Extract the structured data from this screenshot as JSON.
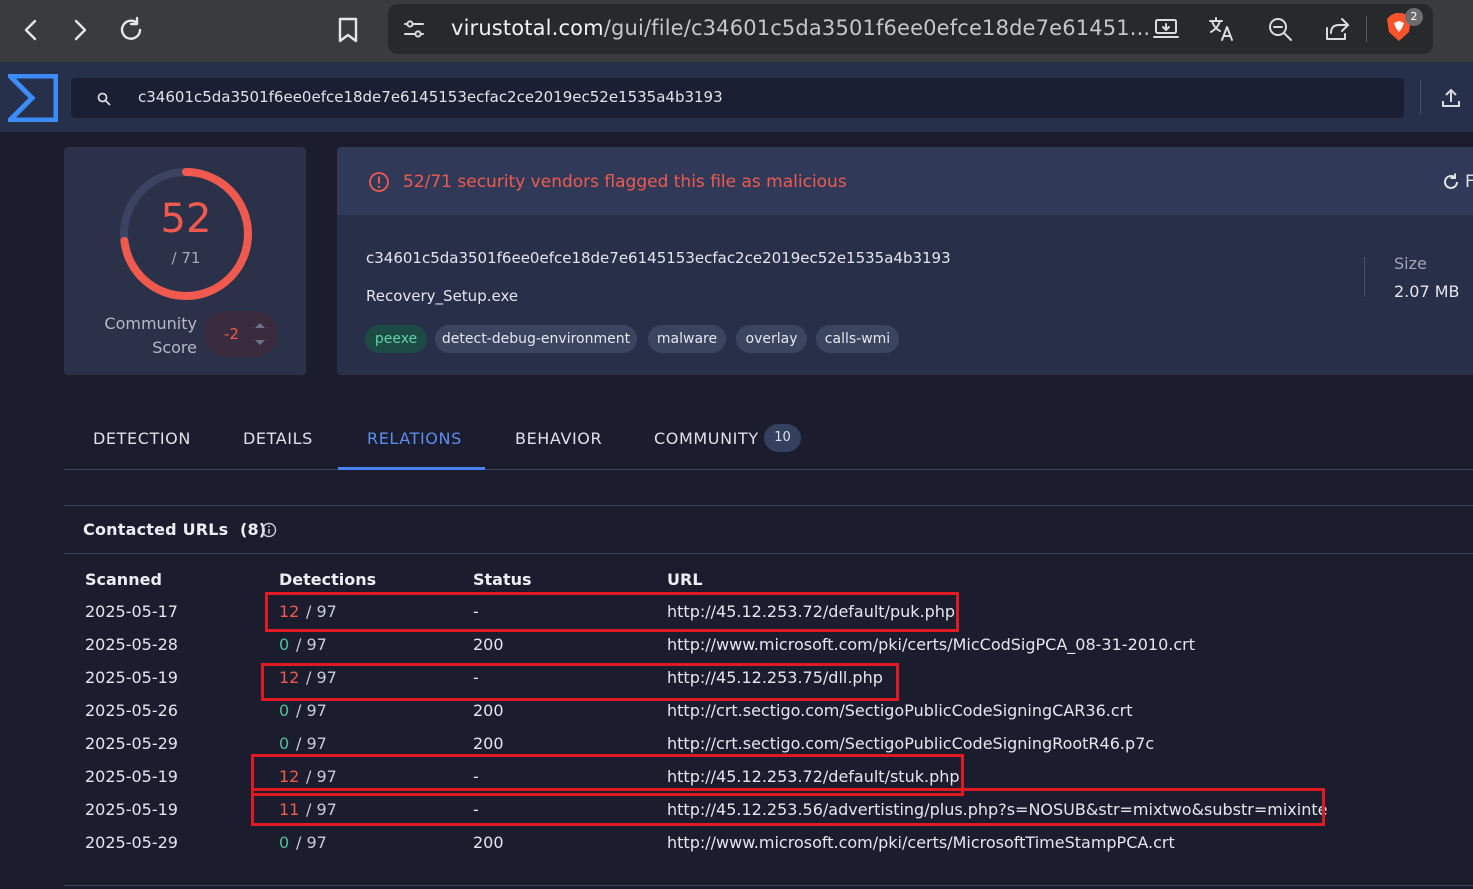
{
  "browser": {
    "url_domain": "virustotal.com",
    "url_path": "/gui/file/c34601c5da3501f6ee0efce18de7e61451...",
    "brave_badge": "2"
  },
  "vt": {
    "search_value": "c34601c5da3501f6ee0efce18de7e6145153ecfac2ce2019ec52e1535a4b3193"
  },
  "score": {
    "detections": "52",
    "total": "/ 71",
    "detection_fraction": 0.732,
    "community_label": "Community Score",
    "community_value": "-2"
  },
  "alert": {
    "text": "52/71 security vendors flagged this file as malicious",
    "reanalyze_label": "F"
  },
  "file": {
    "hash": "c34601c5da3501f6ee0efce18de7e6145153ecfac2ce2019ec52e1535a4b3193",
    "name": "Recovery_Setup.exe",
    "tags": [
      "peexe",
      "detect-debug-environment",
      "malware",
      "overlay",
      "calls-wmi"
    ],
    "size_label": "Size",
    "size_value": "2.07 MB"
  },
  "tabs": [
    {
      "label": "DETECTION"
    },
    {
      "label": "DETAILS"
    },
    {
      "label": "RELATIONS",
      "active": true
    },
    {
      "label": "BEHAVIOR"
    },
    {
      "label": "COMMUNITY",
      "badge": "10"
    }
  ],
  "contacted_urls": {
    "title": "Contacted URLs",
    "count": "(8)",
    "columns": [
      "Scanned",
      "Detections",
      "Status",
      "URL"
    ],
    "rows": [
      {
        "scanned": "2025-05-17",
        "det": "12",
        "total": "/ 97",
        "status": "-",
        "url": "http://45.12.253.72/default/puk.php",
        "malicious": true
      },
      {
        "scanned": "2025-05-28",
        "det": "0",
        "total": "/ 97",
        "status": "200",
        "url": "http://www.microsoft.com/pki/certs/MicCodSigPCA_08-31-2010.crt",
        "malicious": false
      },
      {
        "scanned": "2025-05-19",
        "det": "12",
        "total": "/ 97",
        "status": "-",
        "url": "http://45.12.253.75/dll.php",
        "malicious": true
      },
      {
        "scanned": "2025-05-26",
        "det": "0",
        "total": "/ 97",
        "status": "200",
        "url": "http://crt.sectigo.com/SectigoPublicCodeSigningCAR36.crt",
        "malicious": false
      },
      {
        "scanned": "2025-05-29",
        "det": "0",
        "total": "/ 97",
        "status": "200",
        "url": "http://crt.sectigo.com/SectigoPublicCodeSigningRootR46.p7c",
        "malicious": false
      },
      {
        "scanned": "2025-05-19",
        "det": "12",
        "total": "/ 97",
        "status": "-",
        "url": "http://45.12.253.72/default/stuk.php",
        "malicious": true
      },
      {
        "scanned": "2025-05-19",
        "det": "11",
        "total": "/ 97",
        "status": "-",
        "url": "http://45.12.253.56/advertisting/plus.php?s=NOSUB&str=mixtwo&substr=mixinte",
        "malicious": true
      },
      {
        "scanned": "2025-05-29",
        "det": "0",
        "total": "/ 97",
        "status": "200",
        "url": "http://www.microsoft.com/pki/certs/MicrosoftTimeStampPCA.crt",
        "malicious": false
      }
    ]
  },
  "colors": {
    "malicious": "#f05a4e",
    "clean": "#4fbf9a",
    "annotation": "#e01a22",
    "active_tab": "#5a8ff0"
  }
}
